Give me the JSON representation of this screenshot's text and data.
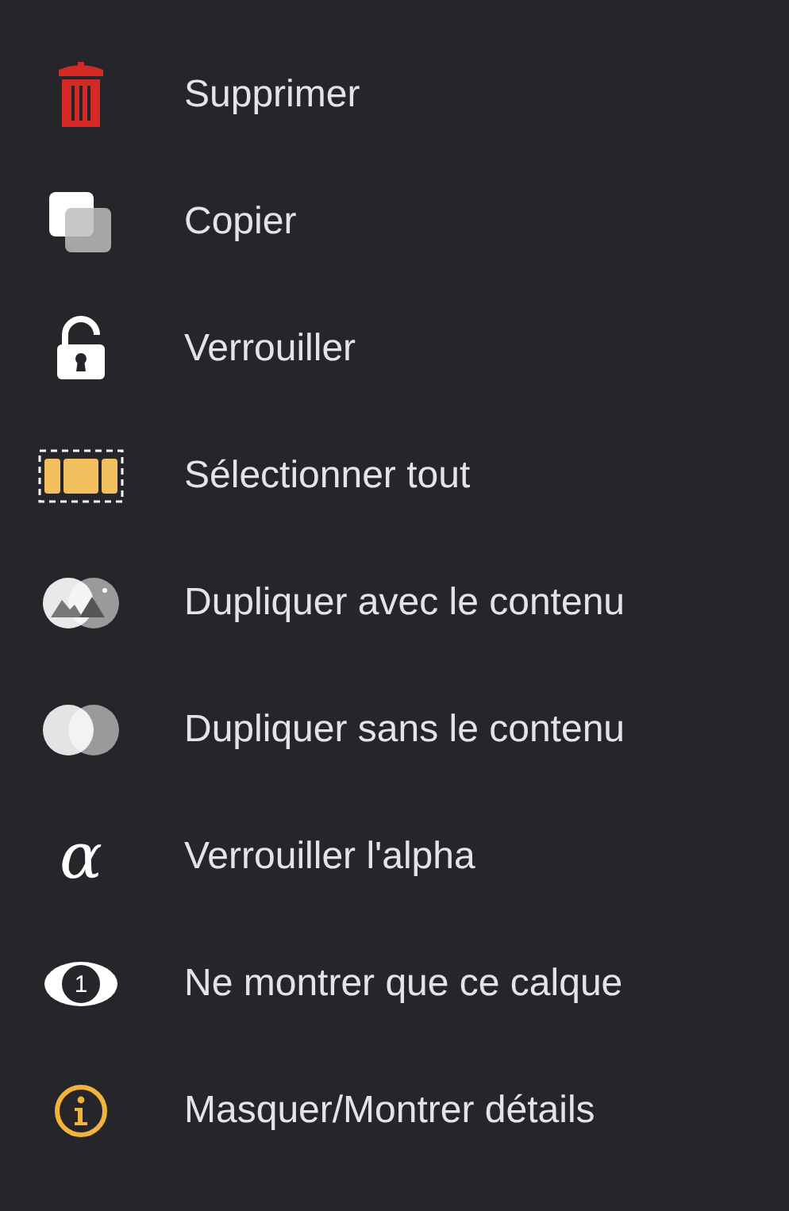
{
  "menu": [
    {
      "kind": "trash",
      "label": "Supprimer"
    },
    {
      "kind": "copy",
      "label": "Copier"
    },
    {
      "kind": "unlock",
      "label": "Verrouiller"
    },
    {
      "kind": "select",
      "label": "Sélectionner tout"
    },
    {
      "kind": "duplicate-content",
      "label": "Dupliquer avec le contenu"
    },
    {
      "kind": "duplicate",
      "label": "Dupliquer sans le contenu"
    },
    {
      "kind": "alpha",
      "glyph": "α",
      "label": "Verrouiller l'alpha"
    },
    {
      "kind": "eye",
      "glyph": "1",
      "label": "Ne montrer que ce calque"
    },
    {
      "kind": "info",
      "label": "Masquer/Montrer détails"
    }
  ]
}
